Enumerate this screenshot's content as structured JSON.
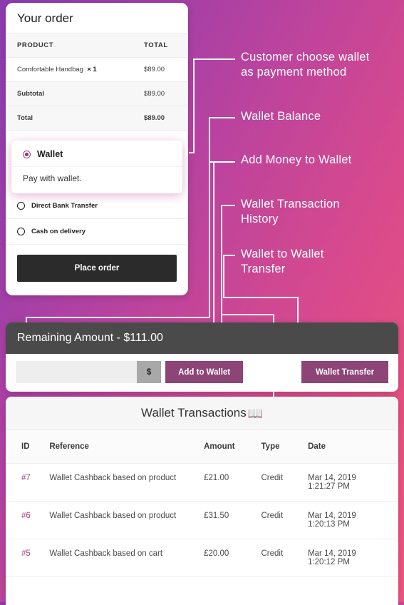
{
  "checkout": {
    "title": "Your order",
    "columns": {
      "product": "PRODUCT",
      "total": "TOTAL"
    },
    "items": [
      {
        "name": "Comfortable Handbag",
        "qty": "× 1",
        "amount": "$89.00"
      }
    ],
    "subtotal_label": "Subtotal",
    "subtotal_value": "$89.00",
    "total_label": "Total",
    "total_value": "$89.00",
    "payment_methods": [
      {
        "label": "Wallet",
        "selected": true,
        "description": "Pay with wallet."
      },
      {
        "label": "Direct Bank Transfer",
        "selected": false
      },
      {
        "label": "Cash on delivery",
        "selected": false
      }
    ],
    "place_order_label": "Place order"
  },
  "annotations": [
    {
      "id": "a1",
      "text": "Customer choose wallet\nas payment method"
    },
    {
      "id": "a2",
      "text": "Wallet Balance"
    },
    {
      "id": "a3",
      "text": "Add Money to Wallet"
    },
    {
      "id": "a4",
      "text": "Wallet Transaction\nHistory"
    },
    {
      "id": "a5",
      "text": "Wallet to Wallet\nTransfer"
    }
  ],
  "wallet_bar": {
    "heading": "Remaining Amount - $111.00",
    "amount_placeholder": "",
    "amount_value": "",
    "currency_symbol": "$",
    "add_button": "Add to Wallet",
    "transfer_button": "Wallet Transfer"
  },
  "transactions": {
    "title": "Wallet Transactions",
    "title_icon": "book-icon",
    "columns": [
      "ID",
      "Reference",
      "Amount",
      "Type",
      "Date"
    ],
    "rows": [
      {
        "id": "#7",
        "reference": "Wallet Cashback based on product",
        "amount": "£21.00",
        "type": "Credit",
        "date1": "Mar 14, 2019",
        "date2": "1:21:27 PM"
      },
      {
        "id": "#6",
        "reference": "Wallet Cashback based on product",
        "amount": "£31.50",
        "type": "Credit",
        "date1": "Mar 14, 2019",
        "date2": "1:20:13 PM"
      },
      {
        "id": "#5",
        "reference": "Wallet Cashback based on cart",
        "amount": "£20.00",
        "type": "Credit",
        "date1": "Mar 14, 2019",
        "date2": "1:20:12 PM"
      }
    ]
  },
  "colors": {
    "gradient_start": "#8c3cb2",
    "gradient_end": "#e8527f",
    "accent_purple": "#8d4477",
    "dark_bar": "#4a4a4a",
    "id_link": "#a8427e",
    "place_order_bg": "#2b2b2b"
  }
}
